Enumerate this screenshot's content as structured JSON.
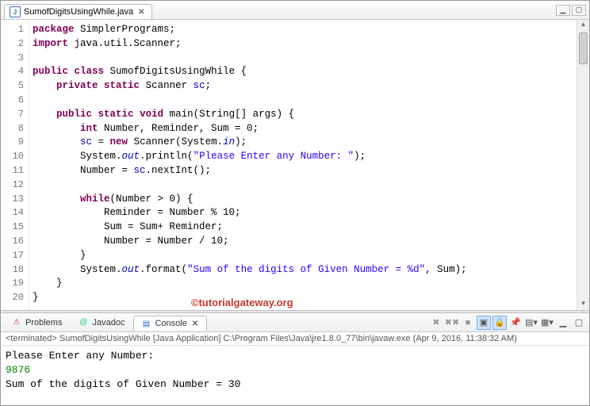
{
  "editor_tab": {
    "filename": "SumofDigitsUsingWhile.java",
    "icon": "J"
  },
  "line_numbers": [
    "1",
    "2",
    "3",
    "4",
    "5",
    "6",
    "7",
    "8",
    "9",
    "10",
    "11",
    "12",
    "13",
    "14",
    "15",
    "16",
    "17",
    "18",
    "19",
    "20"
  ],
  "code": {
    "l1a": "package",
    "l1b": " SimplerPrograms;",
    "l2a": "import",
    "l2b": " java.util.Scanner;",
    "l4a": "public",
    "l4b": " ",
    "l4c": "class",
    "l4d": " SumofDigitsUsingWhile {",
    "l5a": "    ",
    "l5b": "private",
    "l5c": " ",
    "l5d": "static",
    "l5e": " Scanner ",
    "l5f": "sc",
    "l5g": ";",
    "l7a": "    ",
    "l7b": "public",
    "l7c": " ",
    "l7d": "static",
    "l7e": " ",
    "l7f": "void",
    "l7g": " main(String[] args) {",
    "l8a": "        ",
    "l8b": "int",
    "l8c": " Number, Reminder, Sum = 0;",
    "l9a": "        ",
    "l9b": "sc",
    "l9c": " = ",
    "l9d": "new",
    "l9e": " Scanner(System.",
    "l9f": "in",
    "l9g": ");",
    "l10a": "        System.",
    "l10b": "out",
    "l10c": ".println(",
    "l10d": "\"Please Enter any Number: \"",
    "l10e": ");",
    "l11a": "        Number = ",
    "l11b": "sc",
    "l11c": ".nextInt();",
    "l13a": "        ",
    "l13b": "while",
    "l13c": "(Number > 0) {",
    "l14": "            Reminder = Number % 10;",
    "l15": "            Sum = Sum+ Reminder;",
    "l16": "            Number = Number / 10;",
    "l17": "        }",
    "l18a": "        System.",
    "l18b": "out",
    "l18c": ".format(",
    "l18d": "\"Sum of the digits of Given Number = %d\"",
    "l18e": ", Sum);",
    "l19": "    }",
    "l20": "}"
  },
  "watermark": "©tutorialgateway.org",
  "bottom_tabs": {
    "problems": "Problems",
    "javadoc": "Javadoc",
    "console": "Console"
  },
  "terminated_line": "<terminated> SumofDigitsUsingWhile [Java Application] C:\\Program Files\\Java\\jre1.8.0_77\\bin\\javaw.exe (Apr 9, 2016, 11:38:32 AM)",
  "console": {
    "line1": "Please Enter any Number: ",
    "input": "9876",
    "line2": "Sum of the digits of Given Number = 30"
  }
}
